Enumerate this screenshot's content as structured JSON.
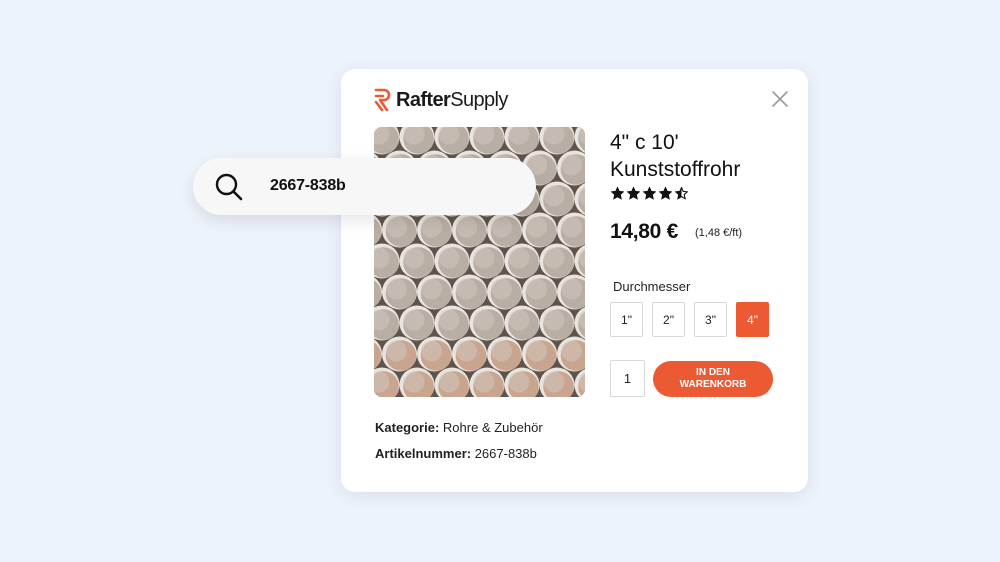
{
  "colors": {
    "background": "#edf3fb",
    "accent": "#ec5a33",
    "card": "#ffffff"
  },
  "search": {
    "value": "2667-838b",
    "icon": "search-icon"
  },
  "brand": {
    "name_bold": "Rafter",
    "name_regular": "Supply",
    "icon": "rafter-supply-logo-icon"
  },
  "dialog": {
    "close_icon": "close-icon"
  },
  "product": {
    "title": "4\" c 10' Kunststoffrohr",
    "rating": 4.5,
    "rating_max": 5,
    "price": "14,80 €",
    "unit_price": "(1,48 €/ft)",
    "image_alt": "Plastic pipes stacked",
    "diameter_label": "Durchmesser",
    "sizes": [
      "1\"",
      "2\"",
      "3\"",
      "4\""
    ],
    "selected_size": "4\"",
    "quantity": "1",
    "add_to_cart": "IN DEN WARENKORB",
    "category_label": "Kategorie:",
    "category_value": "Rohre & Zubehör",
    "sku_label": "Artikelnummer:",
    "sku_value": "2667-838b"
  }
}
